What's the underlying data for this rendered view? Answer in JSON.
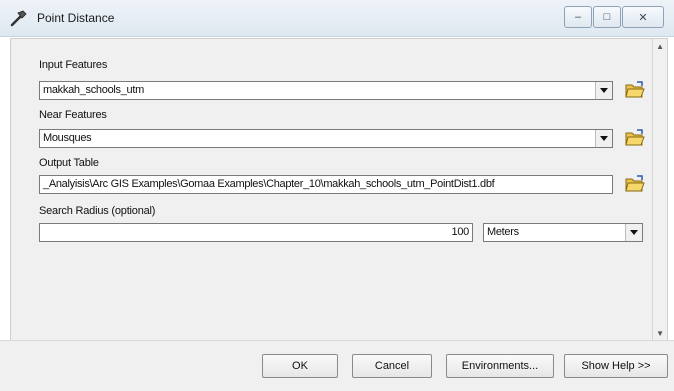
{
  "window": {
    "title": "Point Distance",
    "minimize_glyph": "–",
    "maximize_glyph": "□",
    "close_glyph": "✕"
  },
  "form": {
    "input_features": {
      "label": "Input Features",
      "value": "makkah_schools_utm"
    },
    "near_features": {
      "label": "Near Features",
      "value": "Mousques"
    },
    "output_table": {
      "label": "Output Table",
      "value": "_Analyisis\\Arc GIS Examples\\Gomaa Examples\\Chapter_10\\makkah_schools_utm_PointDist1.dbf"
    },
    "search_radius": {
      "label": "Search Radius (optional)",
      "value": "100",
      "unit": "Meters"
    }
  },
  "buttons": {
    "ok": "OK",
    "cancel": "Cancel",
    "environments": "Environments...",
    "show_help": "Show Help >>"
  },
  "icons": {
    "title": "hammer-icon",
    "browse": "open-folder-icon"
  }
}
